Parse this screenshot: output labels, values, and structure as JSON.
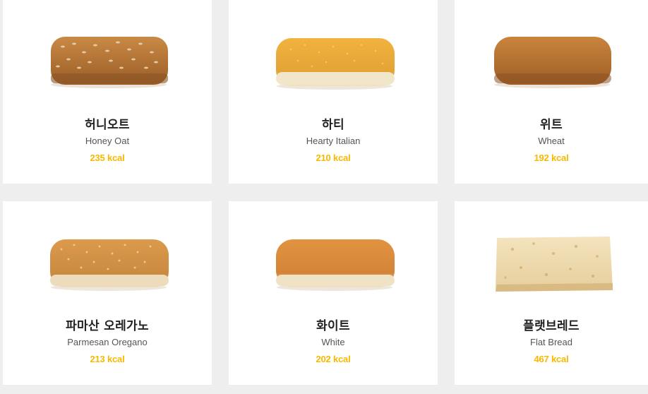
{
  "breads": [
    {
      "name_ko": "허니오트",
      "name_en": "Honey Oat",
      "kcal": "235 kcal",
      "image": "honey-oat-bread"
    },
    {
      "name_ko": "하티",
      "name_en": "Hearty Italian",
      "kcal": "210 kcal",
      "image": "hearty-italian-bread"
    },
    {
      "name_ko": "위트",
      "name_en": "Wheat",
      "kcal": "192 kcal",
      "image": "wheat-bread"
    },
    {
      "name_ko": "파마산 오레가노",
      "name_en": "Parmesan Oregano",
      "kcal": "213 kcal",
      "image": "parmesan-oregano-bread"
    },
    {
      "name_ko": "화이트",
      "name_en": "White",
      "kcal": "202 kcal",
      "image": "white-bread"
    },
    {
      "name_ko": "플랫브레드",
      "name_en": "Flat Bread",
      "kcal": "467 kcal",
      "image": "flat-bread"
    }
  ],
  "colors": {
    "kcal": "#f7b900",
    "card_bg": "#ffffff",
    "page_bg": "#eeeeee"
  }
}
